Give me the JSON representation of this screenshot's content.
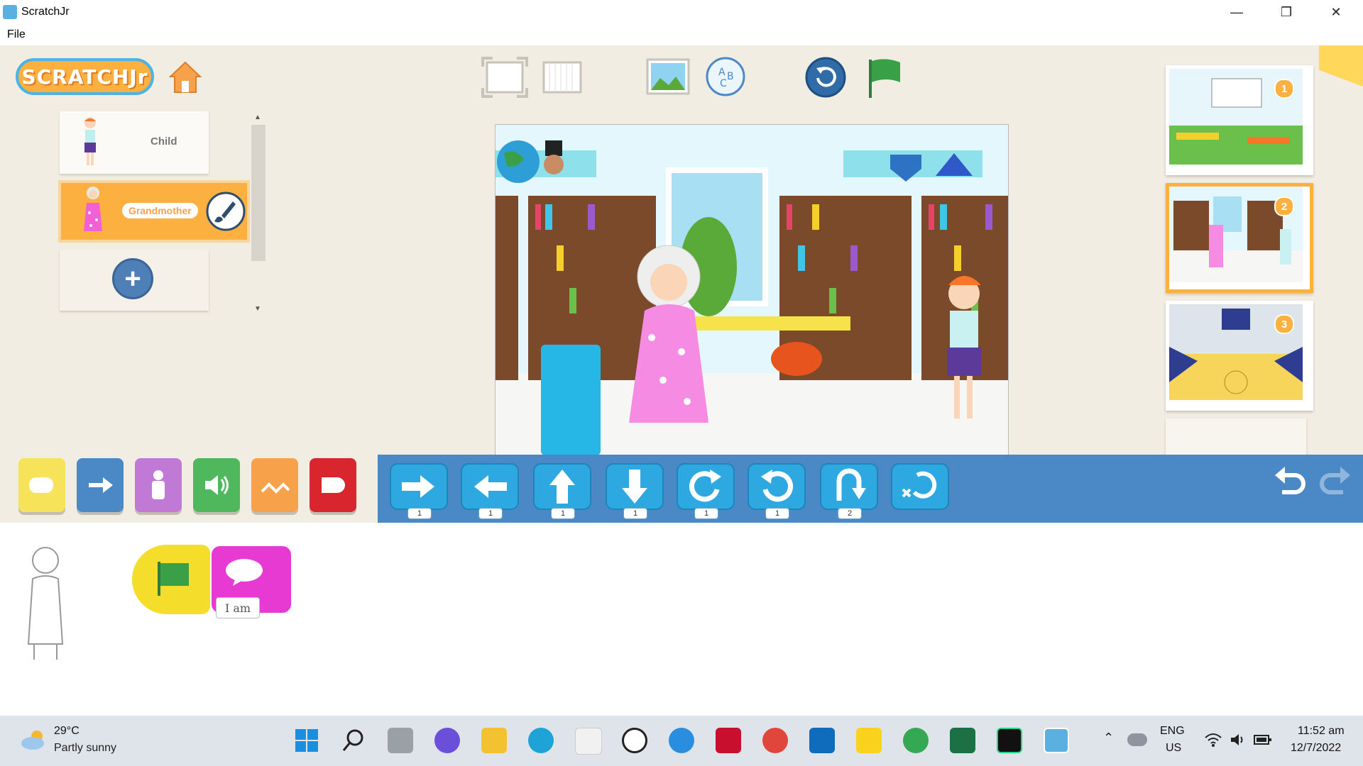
{
  "window": {
    "title": "ScratchJr",
    "minimize": "—",
    "restore": "❐",
    "close": "✕"
  },
  "menu": {
    "file": "File"
  },
  "logo": {
    "text": "SCRATCHJr"
  },
  "sprites": [
    {
      "label": "Child"
    },
    {
      "label": "Grandmother"
    }
  ],
  "add_sprite_icon": "+",
  "blocks": {
    "forward": "1",
    "back": "1",
    "up": "1",
    "down": "1",
    "turn_right": "1",
    "turn_left": "1",
    "hop": "2"
  },
  "script": {
    "say_text": "I am"
  },
  "thumbnails": [
    "1",
    "2",
    "3"
  ],
  "colors": {
    "accent_orange": "#fcb040",
    "motion_blue": "#4b88c6",
    "trigger_yellow": "#f5de2b",
    "looks_purple": "#c07ad6",
    "sound_green": "#4fb85c",
    "control_orange": "#f7a14a",
    "end_red": "#d9262e",
    "say_pink": "#e63ad2"
  },
  "taskbar": {
    "weather_temp": "29°C",
    "weather_desc": "Partly sunny",
    "lang_1": "ENG",
    "lang_2": "US",
    "time": "11:52 am",
    "date": "12/7/2022"
  }
}
